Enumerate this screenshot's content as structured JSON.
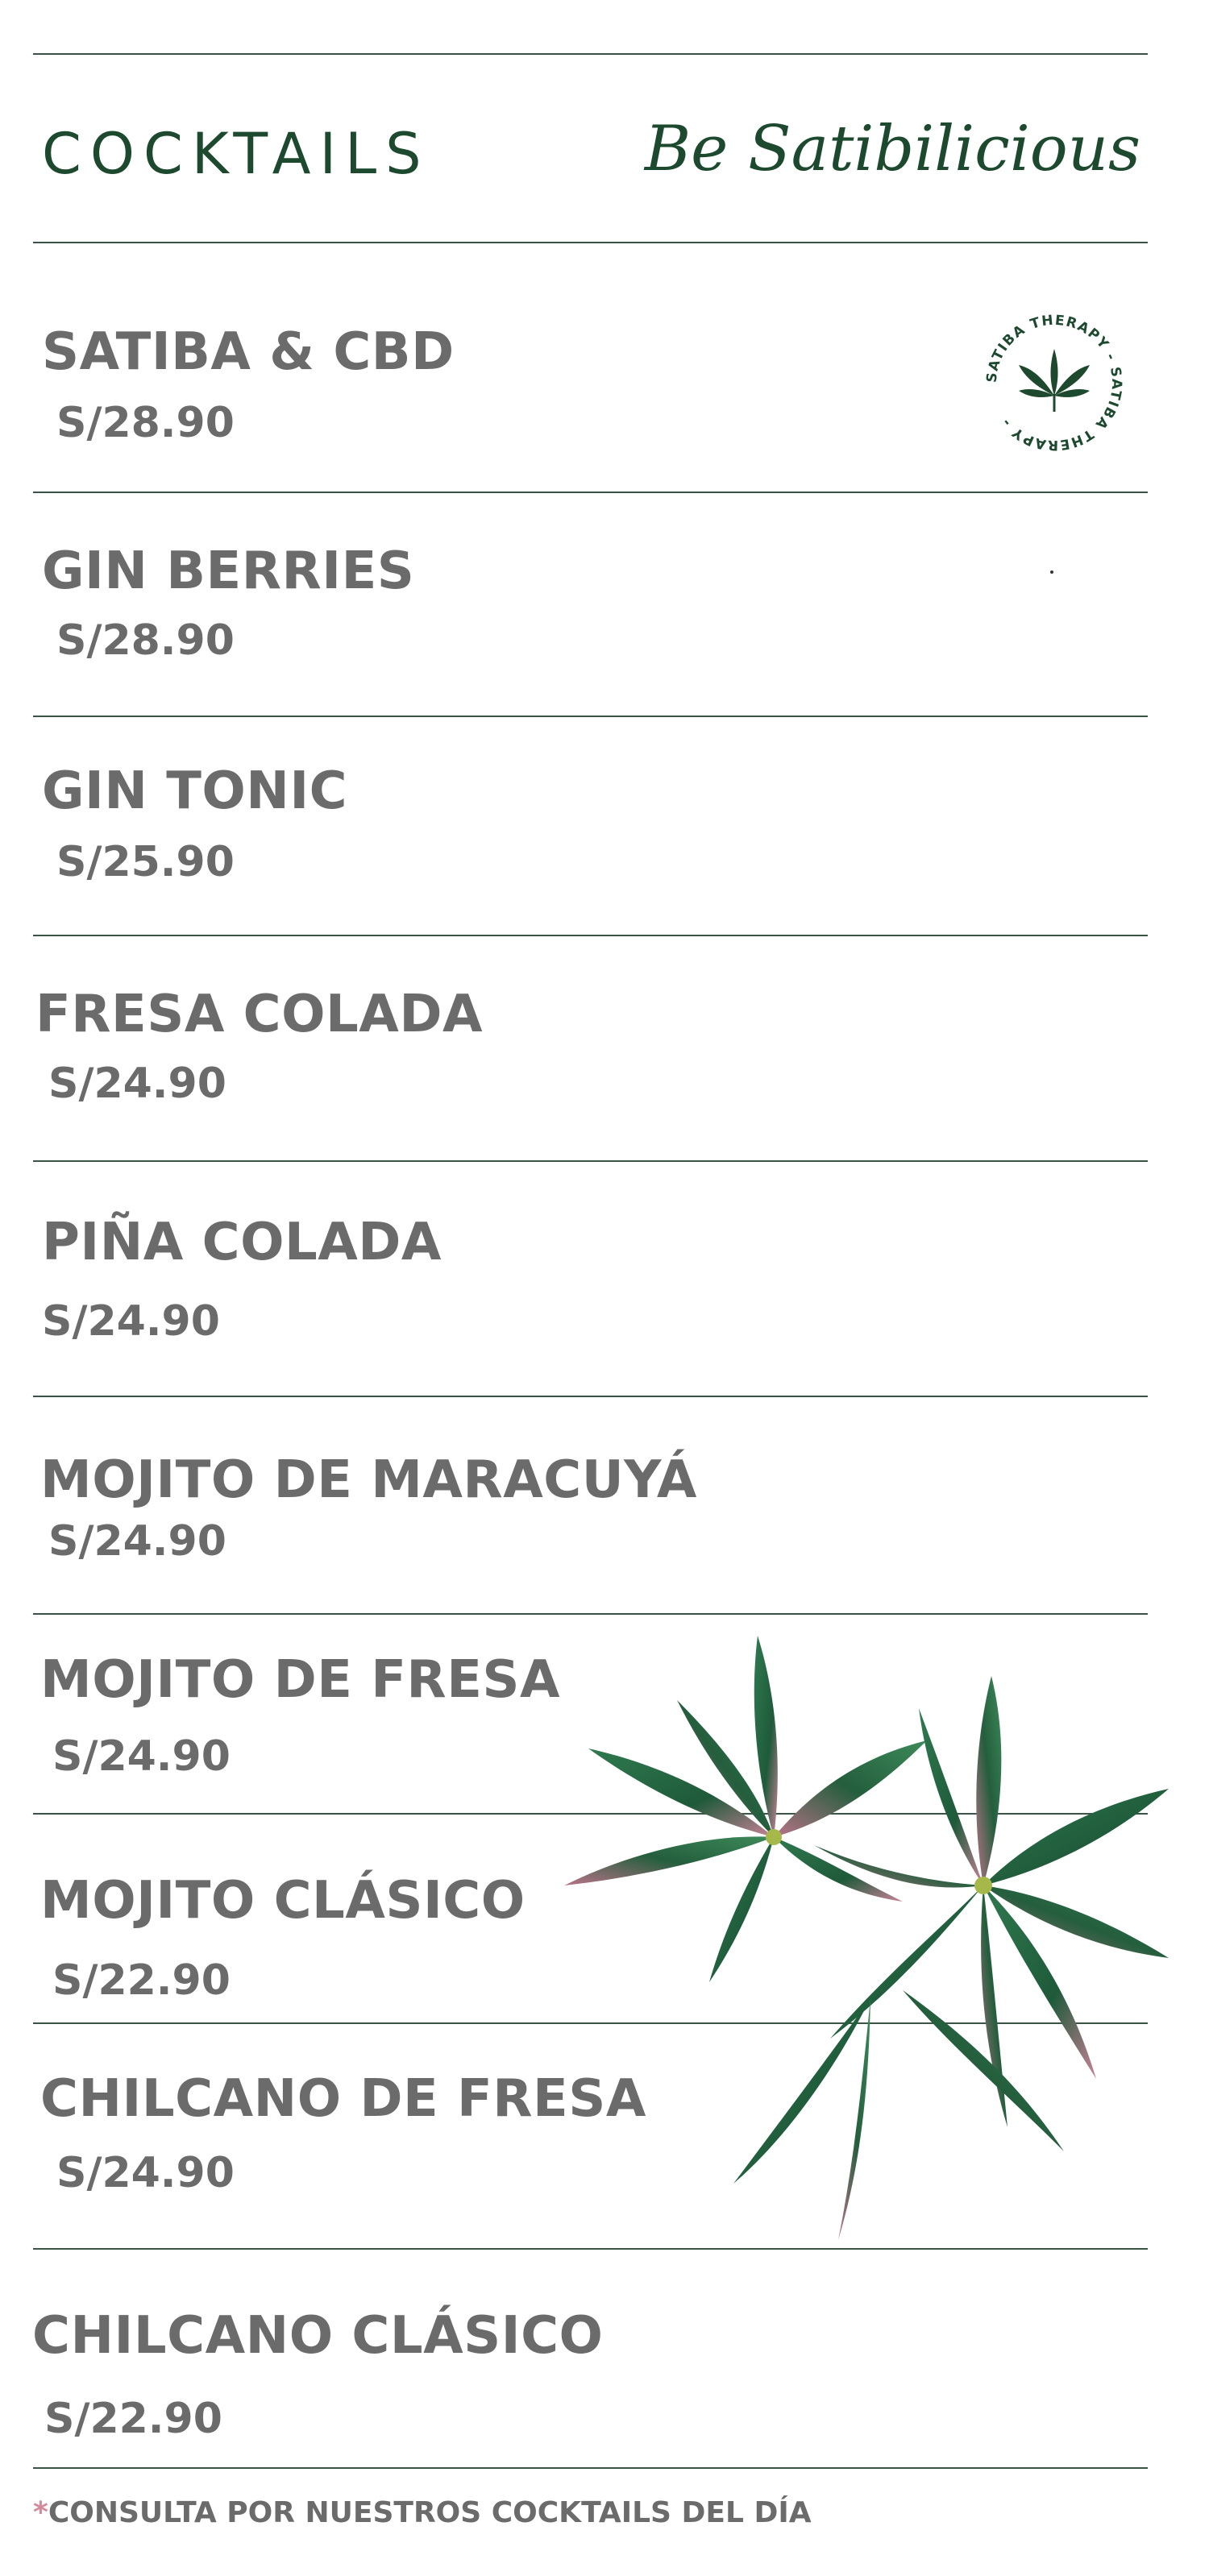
{
  "header": {
    "title": "COCKTAILS",
    "slogan": "Be Satibilicious"
  },
  "badge": {
    "text": "SATIBA THERAPY - SATIBA THERAPY - ",
    "icon": "cannabis-leaf-icon"
  },
  "menu": {
    "items": [
      {
        "name": "SATIBA & CBD",
        "price": "S/28.90"
      },
      {
        "name": "GIN BERRIES",
        "price": "S/28.90"
      },
      {
        "name": "GIN TONIC",
        "price": "S/25.90"
      },
      {
        "name": "FRESA COLADA",
        "price": "S/24.90"
      },
      {
        "name": "PIÑA COLADA",
        "price": "S/24.90"
      },
      {
        "name": "MOJITO DE MARACUYÁ",
        "price": "S/24.90"
      },
      {
        "name": "MOJITO DE FRESA",
        "price": "S/24.90"
      },
      {
        "name": "MOJITO CLÁSICO",
        "price": "S/22.90"
      },
      {
        "name": "CHILCANO DE FRESA",
        "price": "S/24.90"
      },
      {
        "name": "CHILCANO CLÁSICO",
        "price": "S/22.90"
      }
    ]
  },
  "footer": {
    "asterisk": "*",
    "note": "CONSULTA POR NUESTROS COCKTAILS DEL DÍA"
  },
  "colors": {
    "brand_green": "#1d4a2f",
    "text_gray": "#6b6b6b",
    "accent_pink": "#d48a9a",
    "rule": "#3b5446"
  }
}
